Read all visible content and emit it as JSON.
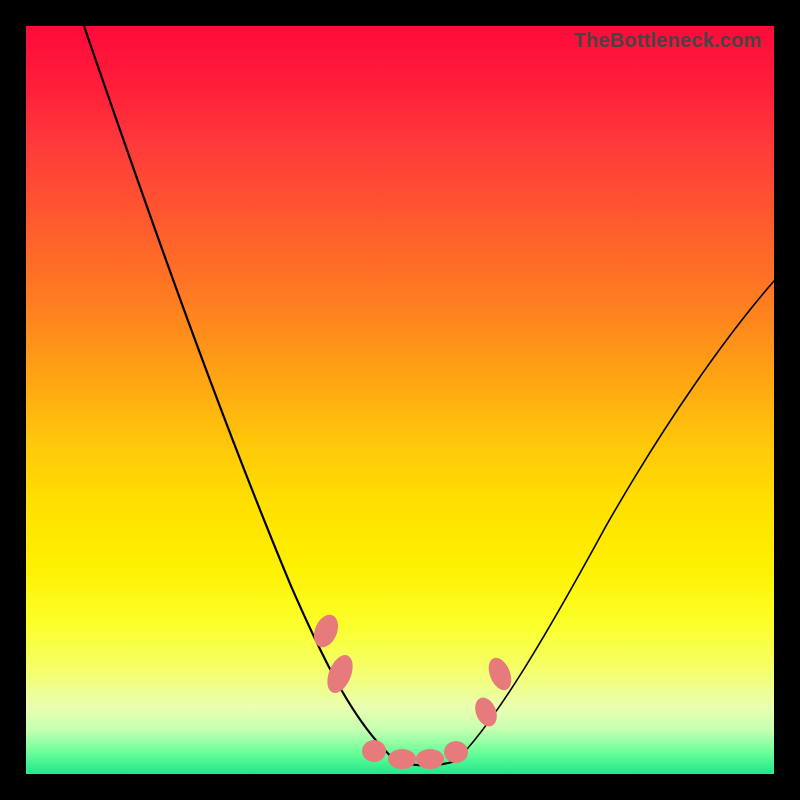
{
  "attribution": "TheBottleneck.com",
  "colors": {
    "frame": "#000000",
    "curve": "#000000",
    "marker": "#e77a7a"
  },
  "chart_data": {
    "type": "line",
    "title": "",
    "xlabel": "",
    "ylabel": "",
    "xlim": [
      0,
      100
    ],
    "ylim": [
      0,
      100
    ],
    "grid": false,
    "legend": false,
    "series": [
      {
        "name": "bottleneck-curve",
        "x": [
          0,
          5,
          10,
          15,
          20,
          25,
          30,
          35,
          40,
          45,
          48,
          50,
          52,
          55,
          58,
          62,
          68,
          75,
          82,
          90,
          100
        ],
        "y": [
          100,
          92,
          82,
          72,
          62,
          52,
          42,
          32,
          22,
          12,
          6,
          2,
          1,
          2,
          6,
          12,
          22,
          35,
          47,
          58,
          68
        ]
      }
    ],
    "markers": [
      {
        "name": "left-cluster-upper",
        "x": 41,
        "y": 18
      },
      {
        "name": "left-cluster-lower",
        "x": 43,
        "y": 11
      },
      {
        "name": "valley-flat-1",
        "x": 47,
        "y": 3
      },
      {
        "name": "valley-flat-2",
        "x": 50,
        "y": 2
      },
      {
        "name": "valley-flat-3",
        "x": 53,
        "y": 2
      },
      {
        "name": "valley-flat-4",
        "x": 56,
        "y": 3
      },
      {
        "name": "right-cluster-lower",
        "x": 60,
        "y": 9
      },
      {
        "name": "right-cluster-upper",
        "x": 62,
        "y": 15
      }
    ],
    "background_gradient": {
      "direction": "vertical",
      "stops": [
        {
          "pos": 0,
          "color": "#ff0a3a"
        },
        {
          "pos": 50,
          "color": "#ffc80a"
        },
        {
          "pos": 80,
          "color": "#fcff2a"
        },
        {
          "pos": 100,
          "color": "#20e88a"
        }
      ]
    }
  }
}
